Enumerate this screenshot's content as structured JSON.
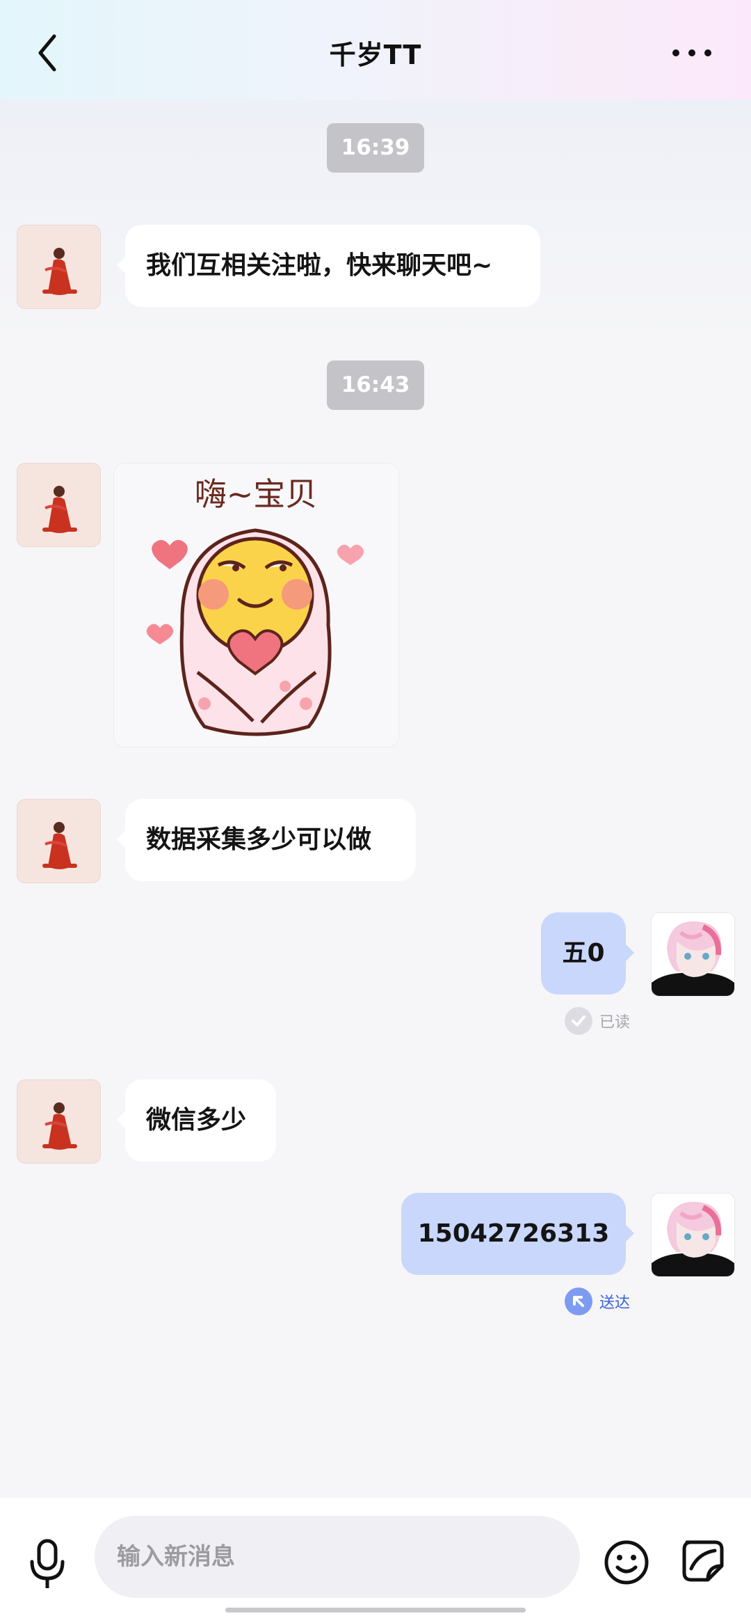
{
  "header": {
    "title": "千岁TT",
    "back_icon": "chevron-left-icon",
    "more_icon": "more-dots-icon"
  },
  "messages": [
    {
      "kind": "time",
      "text": "16:39"
    },
    {
      "kind": "text",
      "side": "left",
      "text": "我们互相关注啦，快来聊天吧~"
    },
    {
      "kind": "time",
      "text": "16:43"
    },
    {
      "kind": "sticker",
      "side": "left",
      "caption": "嗨~宝贝"
    },
    {
      "kind": "text",
      "side": "left",
      "text": "数据采集多少可以做"
    },
    {
      "kind": "text",
      "side": "right",
      "text": "五0",
      "status": "已读"
    },
    {
      "kind": "text",
      "side": "left",
      "text": "微信多少"
    },
    {
      "kind": "text",
      "side": "right",
      "text": "15042726313",
      "status": "送达"
    }
  ],
  "composer": {
    "placeholder": "输入新消息",
    "mic_icon": "microphone-icon",
    "emoji_icon": "smiley-icon",
    "sticker_icon": "sticker-icon"
  },
  "colors": {
    "my_bubble": "#c9d7fc",
    "their_bubble": "#ffffff",
    "time_badge": "#c4c4c8",
    "delivered_blue": "#3b63d8",
    "read_gray": "#b8b8c0"
  }
}
